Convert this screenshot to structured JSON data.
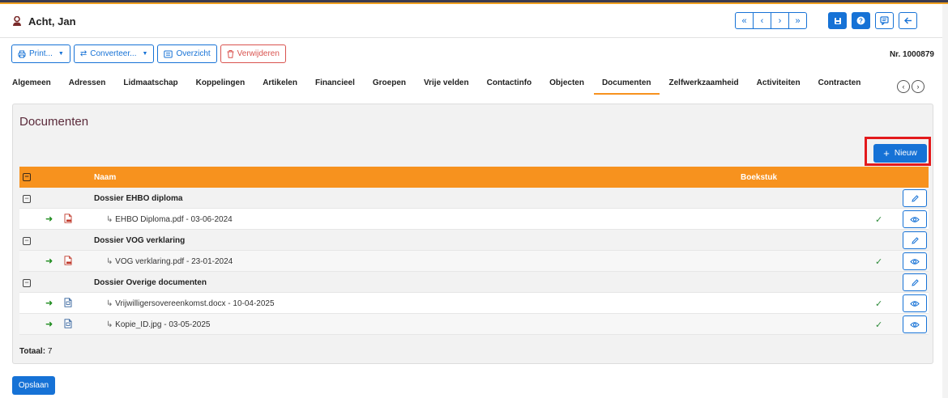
{
  "header": {
    "title": "Acht, Jan",
    "pager": [
      "«",
      "‹",
      "›",
      "»"
    ],
    "actions": [
      "save-icon",
      "help-icon",
      "comment-icon",
      "back-arrow-icon"
    ]
  },
  "toolbar": {
    "print_label": "Print...",
    "convert_label": "Converteer...",
    "overview_label": "Overzicht",
    "delete_label": "Verwijderen",
    "record_nr": "Nr. 1000879"
  },
  "tabs": [
    {
      "label": "Algemeen",
      "active": false
    },
    {
      "label": "Adressen",
      "active": false
    },
    {
      "label": "Lidmaatschap",
      "active": false
    },
    {
      "label": "Koppelingen",
      "active": false
    },
    {
      "label": "Artikelen",
      "active": false
    },
    {
      "label": "Financieel",
      "active": false
    },
    {
      "label": "Groepen",
      "active": false
    },
    {
      "label": "Vrije velden",
      "active": false
    },
    {
      "label": "Contactinfo",
      "active": false
    },
    {
      "label": "Objecten",
      "active": false
    },
    {
      "label": "Documenten",
      "active": true
    },
    {
      "label": "Zelfwerkzaamheid",
      "active": false
    },
    {
      "label": "Activiteiten",
      "active": false
    },
    {
      "label": "Contracten",
      "active": false
    }
  ],
  "panel": {
    "title": "Documenten",
    "new_label": "Nieuw",
    "columns": {
      "naam": "Naam",
      "boekstuk": "Boekstuk"
    },
    "groups": [
      {
        "title": "Dossier EHBO diploma",
        "docs": [
          {
            "text": "EHBO Diploma.pdf - 03-06-2024",
            "type": "pdf",
            "boekstuk": true
          }
        ]
      },
      {
        "title": "Dossier VOG verklaring",
        "docs": [
          {
            "text": "VOG verklaring.pdf - 23-01-2024",
            "type": "pdf",
            "boekstuk": true
          }
        ]
      },
      {
        "title": "Dossier Overige documenten",
        "docs": [
          {
            "text": "Vrijwilligersovereenkomst.docx - 10-04-2025",
            "type": "docx",
            "boekstuk": true
          },
          {
            "text": "Kopie_ID.jpg - 03-05-2025",
            "type": "jpg",
            "boekstuk": true
          }
        ]
      }
    ],
    "totaal_label": "Totaal:",
    "totaal_value": "7"
  },
  "footer": {
    "save_label": "Opslaan"
  },
  "colors": {
    "accent": "#1672d6",
    "header_orange": "#f7921e",
    "highlight_red": "#e31a1c",
    "title_maroon": "#5a2a3a"
  }
}
